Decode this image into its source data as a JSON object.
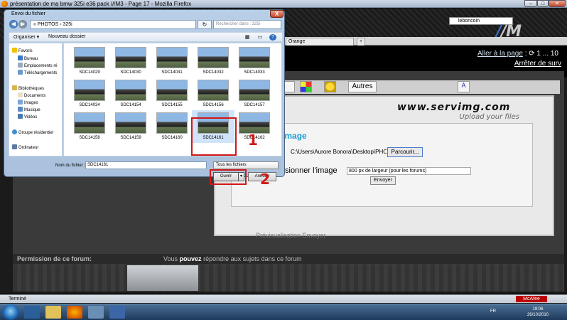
{
  "window": {
    "title": "présentation de ma bmw 325i e36 pack ///M3 - Page 17 - Mozilla Firefox",
    "min": "–",
    "max": "□",
    "close": "✕"
  },
  "browser": {
    "search_value": "leboncoin",
    "tabs": [
      "Orange",
      "+"
    ],
    "logo": "/M"
  },
  "forum": {
    "goto_label": "Aller à la page",
    "goto_pages": ": ⟳ 1 ... 10",
    "stop_link": "Arrêter de surv",
    "autres": "Autres",
    "servimg_title": "www.servimg.com",
    "servimg_sub": "Upload your files",
    "upload_title": "z votre image",
    "file_label": "r",
    "file_path": "C:\\Users\\Aurore Bonora\\Desktop\\PHOT",
    "browse_label": "Parcourir...",
    "resize_label": "sionner l'image",
    "resize_value": "800 px de largeur (pour les forums)",
    "send_label": "Envoyer",
    "ghost_buttons": "Prévisualisation   Envoyer",
    "perm_label": "Permission de ce forum:",
    "perm_text_1": "Vous",
    "perm_text_2": "pouvez",
    "perm_text_3": "répondre aux sujets dans ce forum"
  },
  "statusbar": {
    "text": "Terminé",
    "mcafee": "McAfee"
  },
  "taskbar": {
    "lang": "FR",
    "time": "19:06",
    "date": "26/10/2010"
  },
  "dialog": {
    "title": "Envoi du fichier",
    "close": "X",
    "back": "◀",
    "forward": "▶",
    "address": "« PHOTOS › 325i",
    "refresh": "↻",
    "search_placeholder": "Rechercher dans : 325i",
    "organize": "Organiser ▾",
    "new_folder": "Nouveau dossier",
    "nav_items": [
      "Favoris",
      "Bureau",
      "Emplacements ré",
      "Téléchargements",
      "Bibliothèques",
      "Documents",
      "Images",
      "Musique",
      "Vidéos",
      "Groupe résidentiel",
      "Ordinateur"
    ],
    "files": [
      "SDC14029",
      "SDC14030",
      "SDC14031",
      "SDC14032",
      "SDC14033",
      "SDC14034",
      "SDC14154",
      "SDC14155",
      "SDC14156",
      "SDC14157",
      "SDC14158",
      "SDC14159",
      "SDC14160",
      "SDC14161",
      "SDC14162"
    ],
    "filename_label": "Nom du fichier :",
    "filename_value": "SDC14161",
    "filter_value": "Tous les fichiers",
    "open_label": "Ouvrir",
    "cancel_label": "Annuler",
    "marker_1": "1",
    "marker_2": "2"
  }
}
